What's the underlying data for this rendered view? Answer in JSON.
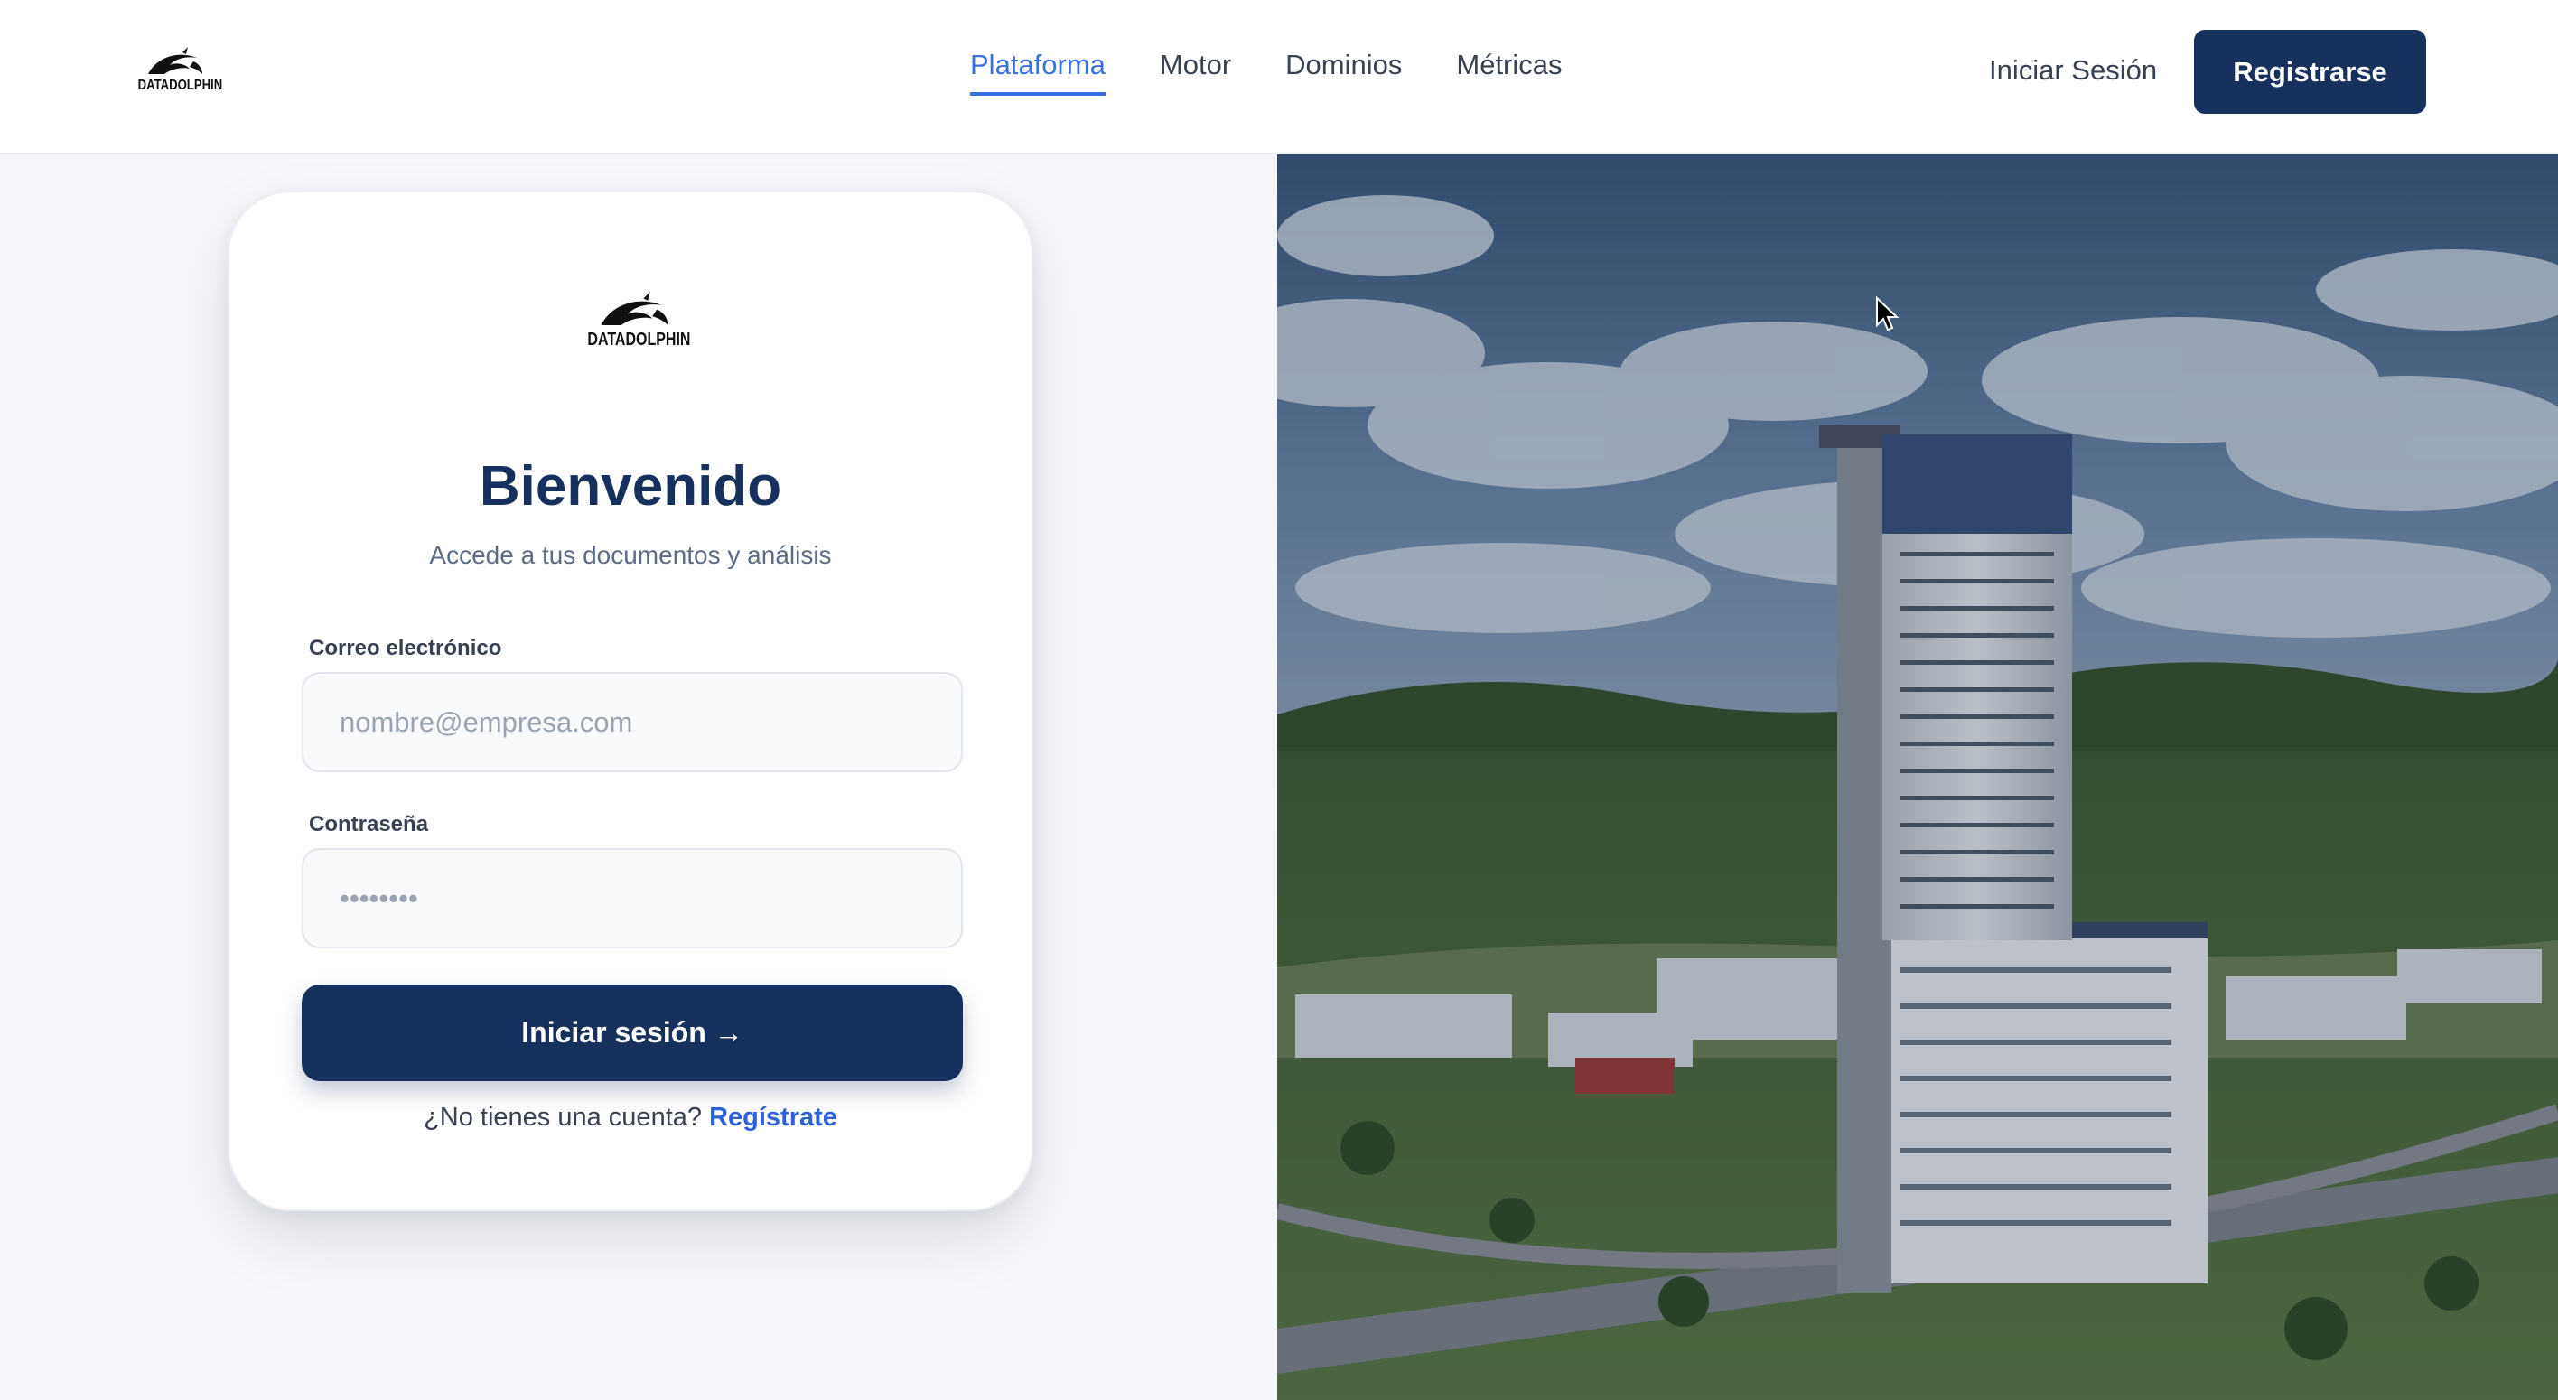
{
  "brand": {
    "name": "DATADOLPHIN"
  },
  "header": {
    "nav": [
      {
        "label": "Plataforma",
        "active": true
      },
      {
        "label": "Motor",
        "active": false
      },
      {
        "label": "Dominios",
        "active": false
      },
      {
        "label": "Métricas",
        "active": false
      }
    ],
    "login_label": "Iniciar Sesión",
    "register_label": "Registrarse"
  },
  "login_card": {
    "title": "Bienvenido",
    "subtitle": "Accede a tus documentos y análisis",
    "email": {
      "label": "Correo electrónico",
      "placeholder": "nombre@empresa.com",
      "value": ""
    },
    "password": {
      "label": "Contraseña",
      "placeholder": "••••••••",
      "value": ""
    },
    "submit_label": "Iniciar sesión →",
    "signup_prompt": "¿No tienes una cuenta?",
    "signup_link": "Regístrate"
  },
  "colors": {
    "brand_navy": "#17305e",
    "accent_blue": "#3b6fe0",
    "link_blue": "#2f62d8"
  },
  "icons": {
    "logo": "dolphin-logo-icon",
    "cursor": "mouse-cursor-icon"
  }
}
